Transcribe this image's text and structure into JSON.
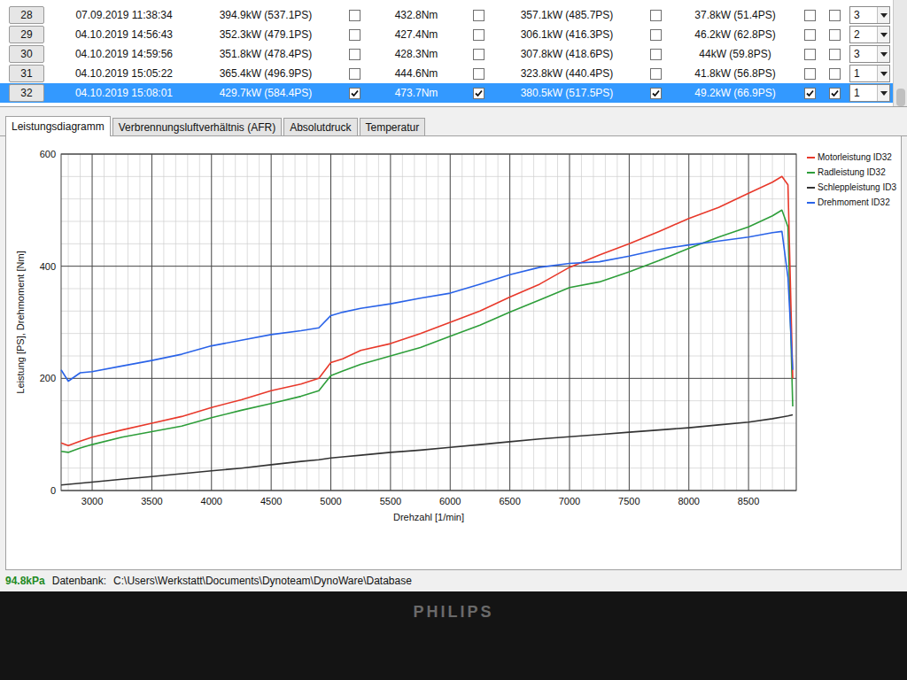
{
  "table": {
    "rows": [
      {
        "no": "28",
        "date": "07.09.2019 11:38:34",
        "power": "394.9kW (537.1PS)",
        "torque": "432.8Nm",
        "wheel": "357.1kW (485.7PS)",
        "drag": "37.8kW (51.4PS)",
        "checks": [
          false,
          false,
          false,
          false,
          false
        ],
        "gear": "3",
        "selected": false
      },
      {
        "no": "29",
        "date": "04.10.2019 14:56:43",
        "power": "352.3kW (479.1PS)",
        "torque": "427.4Nm",
        "wheel": "306.1kW (416.3PS)",
        "drag": "46.2kW (62.8PS)",
        "checks": [
          false,
          false,
          false,
          false,
          false
        ],
        "gear": "2",
        "selected": false
      },
      {
        "no": "30",
        "date": "04.10.2019 14:59:56",
        "power": "351.8kW (478.4PS)",
        "torque": "428.3Nm",
        "wheel": "307.8kW (418.6PS)",
        "drag": "44kW (59.8PS)",
        "checks": [
          false,
          false,
          false,
          false,
          false
        ],
        "gear": "3",
        "selected": false
      },
      {
        "no": "31",
        "date": "04.10.2019 15:05:22",
        "power": "365.4kW (496.9PS)",
        "torque": "444.6Nm",
        "wheel": "323.8kW (440.4PS)",
        "drag": "41.8kW (56.8PS)",
        "checks": [
          false,
          false,
          false,
          false,
          false
        ],
        "gear": "1",
        "selected": false
      },
      {
        "no": "32",
        "date": "04.10.2019 15:08:01",
        "power": "429.7kW (584.4PS)",
        "torque": "473.7Nm",
        "wheel": "380.5kW (517.5PS)",
        "drag": "49.2kW (66.9PS)",
        "checks": [
          true,
          true,
          true,
          true,
          true
        ],
        "gear": "1",
        "selected": true
      }
    ]
  },
  "tabs": [
    {
      "label": "Leistungsdiagramm",
      "selected": true
    },
    {
      "label": "Verbrennungsluftverhältnis (AFR)",
      "selected": false
    },
    {
      "label": "Absolutdruck",
      "selected": false
    },
    {
      "label": "Temperatur",
      "selected": false
    }
  ],
  "chart": {
    "y_axis": {
      "title": "Leistung [PS], Drehmoment [Nm]",
      "ticks": [
        "0",
        "200",
        "400",
        "600"
      ]
    },
    "x_axis": {
      "title": "Drehzahl [1/min]",
      "ticks": [
        "3000",
        "3500",
        "4000",
        "4500",
        "5000",
        "5500",
        "6000",
        "6500",
        "7000",
        "7500",
        "8000",
        "8500"
      ]
    },
    "rpm": [
      2740,
      2800,
      2900,
      3000,
      3250,
      3500,
      3750,
      4000,
      4250,
      4500,
      4750,
      4900,
      5000,
      5100,
      5250,
      5500,
      5750,
      6000,
      6250,
      6500,
      6750,
      7000,
      7250,
      7500,
      7750,
      8000,
      8250,
      8500,
      8700,
      8780,
      8830,
      8870
    ],
    "series": [
      {
        "label": "Motorleistung ID32",
        "color": "#e8392b",
        "values": [
          85,
          80,
          88,
          95,
          108,
          120,
          132,
          148,
          162,
          178,
          190,
          200,
          228,
          235,
          250,
          262,
          280,
          300,
          320,
          345,
          368,
          398,
          420,
          440,
          462,
          485,
          505,
          530,
          550,
          560,
          545,
          200
        ]
      },
      {
        "label": "Radleistung ID32",
        "color": "#2e9e3a",
        "values": [
          70,
          68,
          76,
          82,
          95,
          105,
          115,
          130,
          143,
          155,
          168,
          178,
          205,
          213,
          225,
          240,
          255,
          275,
          295,
          318,
          340,
          362,
          372,
          390,
          410,
          432,
          452,
          470,
          490,
          500,
          470,
          150
        ]
      },
      {
        "label": "Schleppleistung ID3",
        "color": "#333333",
        "values": [
          10,
          11,
          13,
          15,
          20,
          25,
          30,
          35,
          40,
          46,
          52,
          55,
          58,
          60,
          63,
          68,
          72,
          77,
          82,
          87,
          92,
          96,
          100,
          104,
          108,
          112,
          117,
          122,
          128,
          131,
          133,
          135
        ]
      },
      {
        "label": "Drehmoment ID32",
        "color": "#2a63e8",
        "values": [
          215,
          195,
          210,
          212,
          222,
          232,
          243,
          258,
          268,
          278,
          285,
          290,
          312,
          318,
          325,
          333,
          343,
          352,
          368,
          385,
          398,
          405,
          408,
          418,
          430,
          438,
          445,
          452,
          460,
          462,
          380,
          215
        ]
      }
    ]
  },
  "status_bar": {
    "pressure": "94.8kPa",
    "db_label": "Datenbank:",
    "db_path": "C:\\Users\\Werkstatt\\Documents\\Dynoteam\\DynoWare\\Database"
  },
  "bezel": {
    "logo": "PHILIPS"
  }
}
